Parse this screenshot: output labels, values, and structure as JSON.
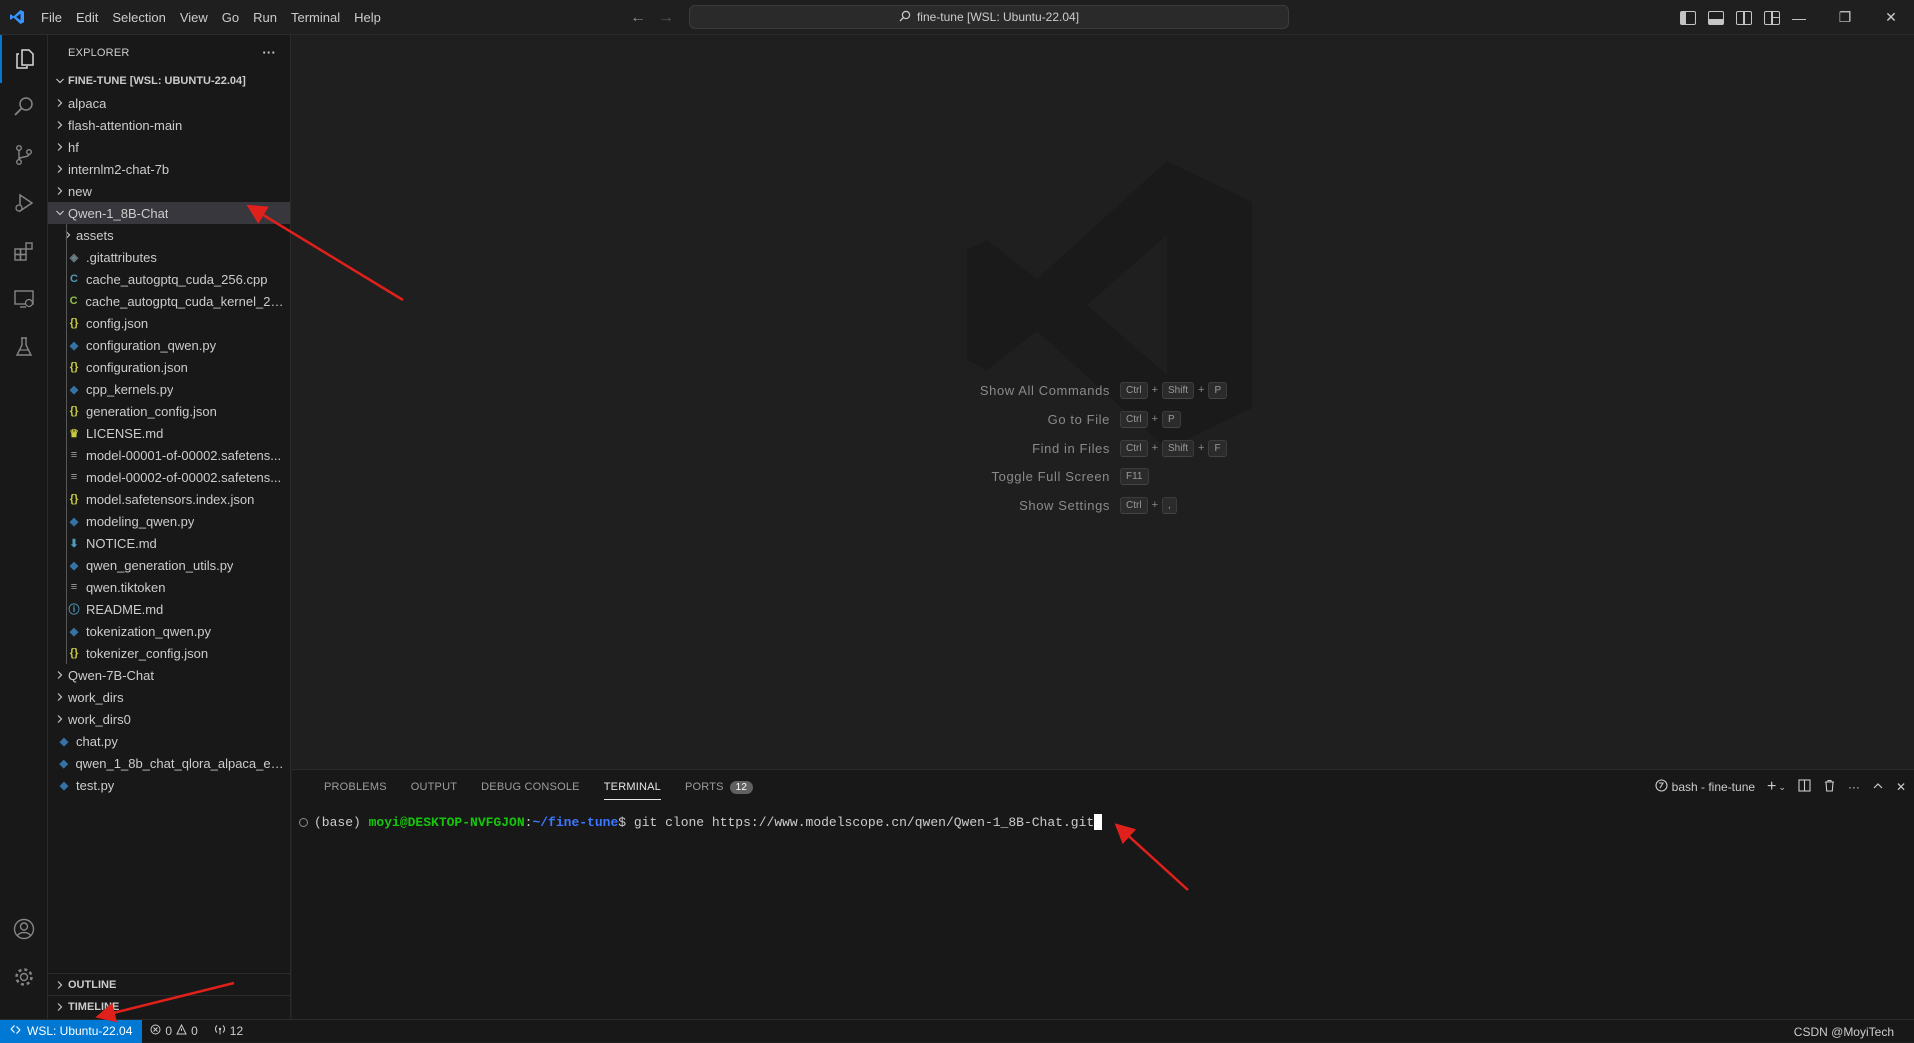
{
  "window": {
    "command_center": "fine-tune [WSL: Ubuntu-22.04]",
    "menu": [
      "File",
      "Edit",
      "Selection",
      "View",
      "Go",
      "Run",
      "Terminal",
      "Help"
    ]
  },
  "explorer": {
    "title": "EXPLORER",
    "more_actions": "···",
    "root": "FINE-TUNE [WSL: UBUNTU-22.04]",
    "items": [
      {
        "label": "alpaca",
        "type": "folder",
        "expanded": false,
        "depth": 0
      },
      {
        "label": "flash-attention-main",
        "type": "folder",
        "expanded": false,
        "depth": 0
      },
      {
        "label": "hf",
        "type": "folder",
        "expanded": false,
        "depth": 0
      },
      {
        "label": "internlm2-chat-7b",
        "type": "folder",
        "expanded": false,
        "depth": 0
      },
      {
        "label": "new",
        "type": "folder",
        "expanded": false,
        "depth": 0
      },
      {
        "label": "Qwen-1_8B-Chat",
        "type": "folder",
        "expanded": true,
        "depth": 0,
        "selected": true
      },
      {
        "label": "assets",
        "type": "folder",
        "expanded": false,
        "depth": 1
      },
      {
        "label": ".gitattributes",
        "type": "git",
        "depth": 1
      },
      {
        "label": "cache_autogptq_cuda_256.cpp",
        "type": "cpp",
        "depth": 1
      },
      {
        "label": "cache_autogptq_cuda_kernel_256...",
        "type": "cu",
        "depth": 1
      },
      {
        "label": "config.json",
        "type": "json",
        "depth": 1
      },
      {
        "label": "configuration_qwen.py",
        "type": "py",
        "depth": 1
      },
      {
        "label": "configuration.json",
        "type": "json",
        "depth": 1
      },
      {
        "label": "cpp_kernels.py",
        "type": "py",
        "depth": 1
      },
      {
        "label": "generation_config.json",
        "type": "json",
        "depth": 1
      },
      {
        "label": "LICENSE.md",
        "type": "license",
        "depth": 1
      },
      {
        "label": "model-00001-of-00002.safetens...",
        "type": "text",
        "depth": 1
      },
      {
        "label": "model-00002-of-00002.safetens...",
        "type": "text",
        "depth": 1
      },
      {
        "label": "model.safetensors.index.json",
        "type": "json",
        "depth": 1
      },
      {
        "label": "modeling_qwen.py",
        "type": "py",
        "depth": 1
      },
      {
        "label": "NOTICE.md",
        "type": "md",
        "depth": 1
      },
      {
        "label": "qwen_generation_utils.py",
        "type": "py",
        "depth": 1
      },
      {
        "label": "qwen.tiktoken",
        "type": "text",
        "depth": 1
      },
      {
        "label": "README.md",
        "type": "info",
        "depth": 1
      },
      {
        "label": "tokenization_qwen.py",
        "type": "py",
        "depth": 1
      },
      {
        "label": "tokenizer_config.json",
        "type": "json",
        "depth": 1
      },
      {
        "label": "Qwen-7B-Chat",
        "type": "folder",
        "expanded": false,
        "depth": 0
      },
      {
        "label": "work_dirs",
        "type": "folder",
        "expanded": false,
        "depth": 0
      },
      {
        "label": "work_dirs0",
        "type": "folder",
        "expanded": false,
        "depth": 0
      },
      {
        "label": "chat.py",
        "type": "py",
        "depth": 0
      },
      {
        "label": "qwen_1_8b_chat_qlora_alpaca_e3_...",
        "type": "py",
        "depth": 0
      },
      {
        "label": "test.py",
        "type": "py",
        "depth": 0
      }
    ],
    "outline": "OUTLINE",
    "timeline": "TIMELINE"
  },
  "welcome": {
    "shortcuts": [
      {
        "label": "Show All Commands",
        "keys": [
          "Ctrl",
          "Shift",
          "P"
        ]
      },
      {
        "label": "Go to File",
        "keys": [
          "Ctrl",
          "P"
        ]
      },
      {
        "label": "Find in Files",
        "keys": [
          "Ctrl",
          "Shift",
          "F"
        ]
      },
      {
        "label": "Toggle Full Screen",
        "keys": [
          "F11"
        ]
      },
      {
        "label": "Show Settings",
        "keys": [
          "Ctrl",
          ","
        ]
      }
    ]
  },
  "panel": {
    "tabs": [
      "PROBLEMS",
      "OUTPUT",
      "DEBUG CONSOLE",
      "TERMINAL",
      "PORTS"
    ],
    "active_tab": "TERMINAL",
    "ports_count": "12",
    "terminal_name": "bash - fine-tune",
    "terminal": {
      "prefix": "(base) ",
      "user": "moyi@DESKTOP-NVFGJON",
      "colon": ":",
      "path": "~/fine-tune",
      "dollar": "$ ",
      "command": "git clone https://www.modelscope.cn/qwen/Qwen-1_8B-Chat.git"
    }
  },
  "statusbar": {
    "remote": "WSL: Ubuntu-22.04",
    "errors": "0",
    "warnings": "0",
    "ports": "12",
    "credit": "CSDN @MoyiTech"
  },
  "colors": {
    "accent": "#0078d4",
    "annotation_arrow": "#e0201b",
    "terminal_user": "#16c60c",
    "terminal_path": "#3b78ff"
  }
}
